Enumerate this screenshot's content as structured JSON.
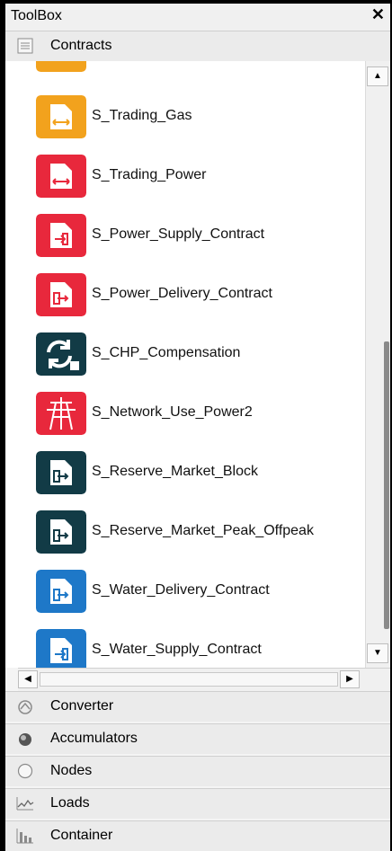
{
  "window": {
    "title": "ToolBox",
    "close_glyph": "✕"
  },
  "contracts_header": {
    "label": "Contracts",
    "icon": "document-icon"
  },
  "items": [
    {
      "label": "",
      "icon": "contract-orange-icon",
      "color": "#f2a21d"
    },
    {
      "label": "S_Trading_Gas",
      "icon": "trading-gas-icon",
      "color": "#f2a21d"
    },
    {
      "label": "S_Trading_Power",
      "icon": "trading-power-icon",
      "color": "#e8283c"
    },
    {
      "label": "S_Power_Supply_Contract",
      "icon": "power-supply-icon",
      "color": "#e8283c"
    },
    {
      "label": "S_Power_Delivery_Contract",
      "icon": "power-delivery-icon",
      "color": "#e8283c"
    },
    {
      "label": "S_CHP_Compensation",
      "icon": "chp-compensation-icon",
      "color": "#123b46"
    },
    {
      "label": "S_Network_Use_Power2",
      "icon": "network-pylon-icon",
      "color": "#e8283c"
    },
    {
      "label": "S_Reserve_Market_Block",
      "icon": "reserve-block-icon",
      "color": "#123b46"
    },
    {
      "label": "S_Reserve_Market_Peak_Offpeak",
      "icon": "reserve-peak-icon",
      "color": "#123b46"
    },
    {
      "label": "S_Water_Delivery_Contract",
      "icon": "water-delivery-icon",
      "color": "#1e78c8"
    },
    {
      "label": "S_Water_Supply_Contract",
      "icon": "water-supply-icon",
      "color": "#1e78c8"
    }
  ],
  "scrollbars": {
    "up": "▲",
    "down": "▼",
    "left": "◀",
    "right": "▶"
  },
  "categories": [
    {
      "label": "Converter",
      "icon": "converter-icon"
    },
    {
      "label": "Accumulators",
      "icon": "accumulator-icon"
    },
    {
      "label": "Nodes",
      "icon": "node-circle-icon"
    },
    {
      "label": "Loads",
      "icon": "loads-chart-icon"
    },
    {
      "label": "Container",
      "icon": "container-bars-icon"
    }
  ]
}
